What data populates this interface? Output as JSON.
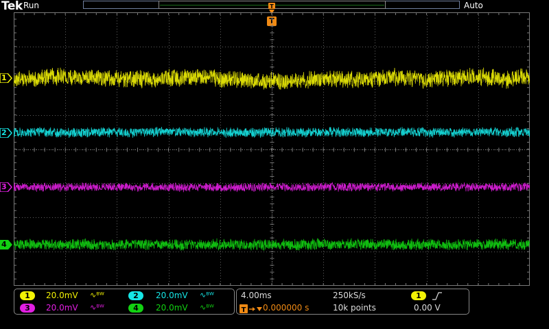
{
  "header": {
    "brand": "Tek",
    "acq_state": "Run",
    "trigger_mode": "Auto"
  },
  "trigger_marker": {
    "label": "T",
    "color": "#f08a14"
  },
  "channels": [
    {
      "id": "1",
      "color": "#f2f205",
      "scale": "20.0mV",
      "bw_icon": "bandwidth-limit-icon"
    },
    {
      "id": "2",
      "color": "#16e6e6",
      "scale": "20.0mV",
      "bw_icon": "bandwidth-limit-icon"
    },
    {
      "id": "3",
      "color": "#e21fe2",
      "scale": "20.0mV",
      "bw_icon": "bandwidth-limit-icon"
    },
    {
      "id": "4",
      "color": "#12d212",
      "scale": "20.0mV",
      "bw_icon": "bandwidth-limit-icon"
    }
  ],
  "horizontal": {
    "time_div": "4.00ms",
    "sample_rate": "250kS/s",
    "trigger_delay": "0.000000 s",
    "record_length": "10k points"
  },
  "trigger": {
    "source": "1",
    "slope_icon": "rising-edge-icon",
    "level": "0.00 V"
  },
  "colors": {
    "graticule": "#7a7a7a",
    "background": "#000000",
    "trigger_orange": "#f08a14"
  }
}
